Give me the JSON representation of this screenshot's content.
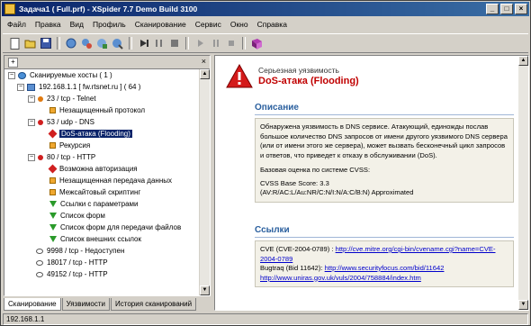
{
  "window": {
    "title": "Задача1 ( Full.prf) - XSpider 7.7 Demo Build 3100"
  },
  "menu": [
    "Файл",
    "Правка",
    "Вид",
    "Профиль",
    "Сканирование",
    "Сервис",
    "Окно",
    "Справка"
  ],
  "toolbar": {
    "icons": [
      "new-icon",
      "open-icon",
      "save-icon",
      "scan-host-icon",
      "scan-net-icon",
      "scan-list-icon",
      "scan-all-icon",
      "start-icon",
      "pause-all-icon",
      "stop-all-icon",
      "play-icon",
      "pause-icon",
      "stop-icon",
      "report-icon"
    ]
  },
  "tree": {
    "root": "Сканируемые хосты ( 1 )",
    "host": "192.168.1.1 [ fw.rtsnet.ru ] ( 64 )",
    "items": [
      {
        "label": "23 / tcp - Telnet"
      },
      {
        "label": "Незащищенный протокол"
      },
      {
        "label": "53 / udp - DNS"
      },
      {
        "label": "DoS-атака (Flooding)"
      },
      {
        "label": "Рекурсия"
      },
      {
        "label": "80 / tcp - HTTP"
      },
      {
        "label": "Возможна авторизация"
      },
      {
        "label": "Незащищенная передача данных"
      },
      {
        "label": "Межсайтовый скриптинг"
      },
      {
        "label": "Ссылки с параметрами"
      },
      {
        "label": "Список форм"
      },
      {
        "label": "Список форм для передачи файлов"
      },
      {
        "label": "Список внешних ссылок"
      },
      {
        "label": "9998 / tcp - Недоступен"
      },
      {
        "label": "18017 / tcp - HTTP"
      },
      {
        "label": "49152 / tcp - HTTP"
      }
    ]
  },
  "tabs": [
    "Сканирование",
    "Уязвимости",
    "История сканирований"
  ],
  "status": {
    "text": "192.168.1.1"
  },
  "details": {
    "severity": "Серьезная уязвимость",
    "name": "DoS-атака (Flooding)",
    "desc_title": "Описание",
    "desc_text": "Обнаружена уязвимость в DNS сервисе. Атакующий, единожды послав большое количество DNS запросов от имени другого уязвимого DNS сервера (или от имени этого же сервера), может вызвать бесконечный цикл запросов и ответов, что приведет к отказу в обслуживании (DoS).",
    "cvss_intro": "Базовая оценка по системе CVSS:",
    "cvss_score": "CVSS Base Score: 3.3",
    "cvss_vector": "(AV:R/AC:L/Au:NR/C:N/I:N/A:C/B:N) Approximated",
    "links_title": "Ссылки",
    "cve_label": "CVE (CVE-2004-0789) :",
    "cve_url": "http://cve.mitre.org/cgi-bin/cvename.cgi?name=CVE-2004-0789",
    "bugtraq_label": "Bugtraq (Bid 11642):",
    "bugtraq_url": "http://www.securityfocus.com/bid/11642",
    "uniras_url": "http://www.uniras.gov.uk/vuls/2004/758884/index.htm"
  },
  "colors": {
    "title_bar": "#0a246a",
    "severity_red": "#c00000",
    "section_blue": "#2a5f9e"
  }
}
